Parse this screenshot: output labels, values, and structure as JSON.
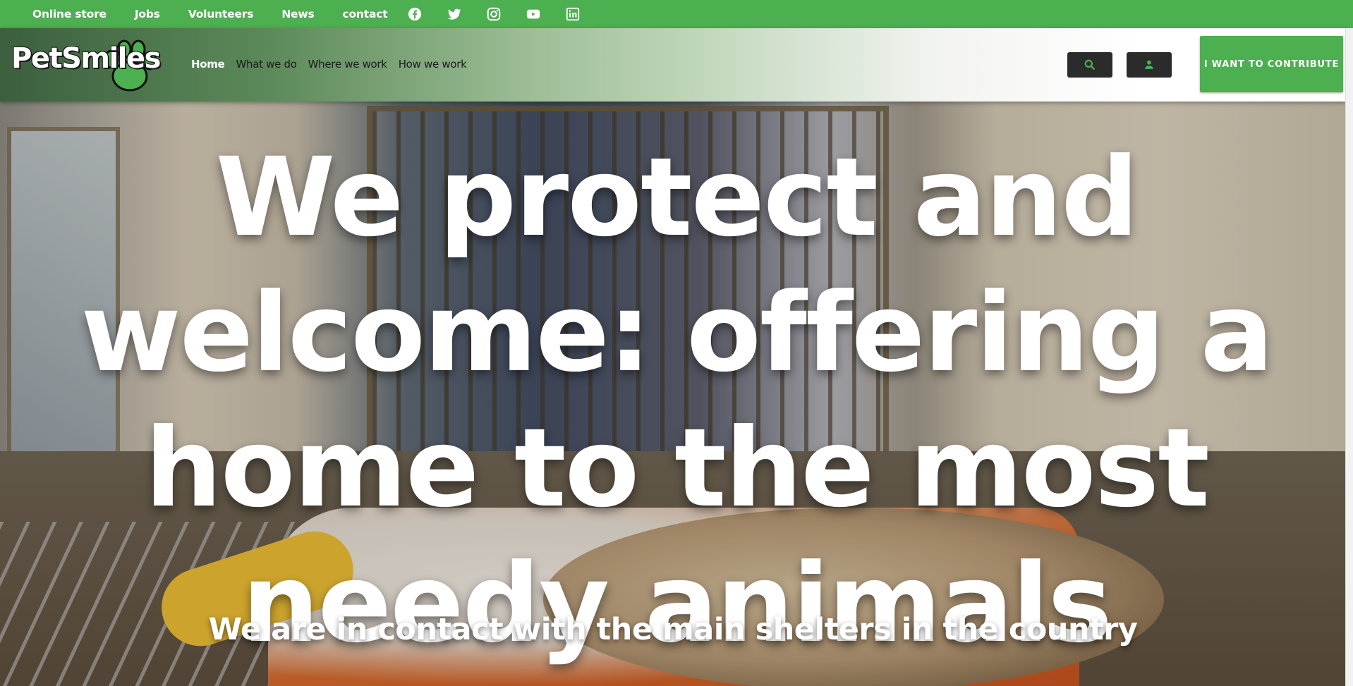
{
  "topbar": {
    "links": [
      "Online store",
      "Jobs",
      "Volunteers",
      "News",
      "contact"
    ],
    "social_icons": [
      "facebook-icon",
      "twitter-icon",
      "instagram-icon",
      "youtube-icon",
      "linkedin-icon"
    ],
    "background": "#4caf50"
  },
  "brand": {
    "logo_text": "PetSmiles",
    "accent": "#4caf50"
  },
  "nav": {
    "items": [
      "Home",
      "What we do",
      "Where we work",
      "How we work"
    ],
    "active": "Home"
  },
  "actions": {
    "search_icon": "search-icon",
    "account_icon": "user-icon",
    "contribute_label": "I WANT TO CONTRIBUTE"
  },
  "hero": {
    "headline": "We protect and welcome: offering a home to the most needy animals",
    "subline": "We are in contact with the main shelters in the country"
  }
}
